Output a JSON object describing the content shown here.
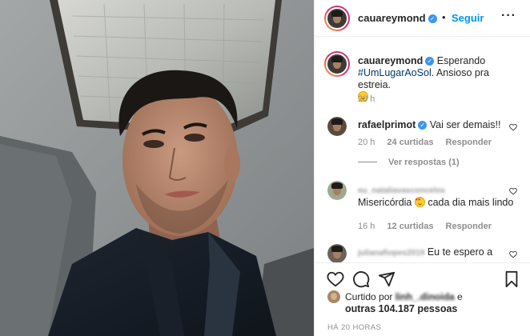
{
  "post": {
    "author": "cauareymond",
    "follow_label": "Seguir",
    "separator": "•",
    "more_label": "···",
    "caption": {
      "username": "cauareymond",
      "text_before": " Esperando ",
      "hashtag": "#UmLugarAoSol",
      "text_after": ". Ansioso pra estreia.",
      "time": "20 h"
    }
  },
  "comments": [
    {
      "username": "rafaelprimot",
      "text": " Vai ser demais!!",
      "time": "20 h",
      "likes": "24 curtidas",
      "reply_label": "Responder",
      "view_replies": "Ver respostas (1)"
    },
    {
      "username": "eu_nataliavasconcelos",
      "text_before": "Misericórdia ",
      "text_after": " cada dia mais lindo",
      "time": "16 h",
      "likes": "12 curtidas",
      "reply_label": "Responder"
    },
    {
      "username": "julianafiopes2019",
      "text": " Eu te espero a"
    }
  ],
  "actions": {
    "liked_prefix": "Curtido por ",
    "liked_user": "linh_.dinoida",
    "liked_suffix": " e",
    "liked_others": "outras 104.187 pessoas",
    "time_ago": "HÁ 20 HORAS"
  },
  "icons": [
    "heart-icon",
    "comment-icon",
    "share-icon",
    "bookmark-icon",
    "more-options-icon",
    "verified-badge-icon"
  ],
  "colors": {
    "link_blue": "#0095f6",
    "verified_blue": "#3897f0",
    "muted_gray": "#8e8e8e",
    "text": "#262626",
    "border": "#efefef"
  }
}
